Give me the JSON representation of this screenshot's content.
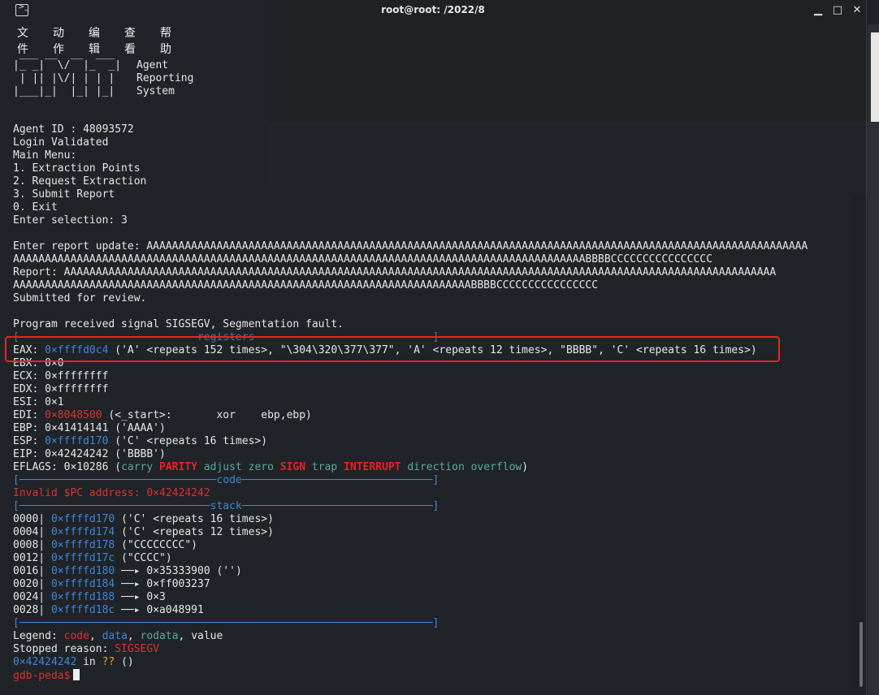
{
  "window": {
    "title": "root@root: /2022/8",
    "min": "▁",
    "max": "□",
    "close": "✕"
  },
  "menu": [
    "文件",
    "动作",
    "编辑",
    "查看",
    "帮助"
  ],
  "banner": {
    "logo_lines": [
      " ___ __  __  ___  ",
      "|_ _|  \\/  |_  _| ",
      " | || |\\/| | | |  ",
      "|___|_|  |_| |_|  "
    ],
    "text": [
      "Agent",
      "Reporting",
      "System"
    ]
  },
  "session": {
    "agent_id": "Agent ID : 48093572",
    "login": "Login Validated",
    "main_menu": "Main Menu:",
    "options": [
      "1. Extraction Points",
      "2. Request Extraction",
      "3. Submit Report",
      "0. Exit"
    ],
    "selection": "Enter selection: 3",
    "update_1": "Enter report update: AAAAAAAAAAAAAAAAAAAAAAAAAAAAAAAAAAAAAAAAAAAAAAAAAAAAAAAAAAAAAAAAAAAAAAAAAAAAAAAAAAAAAAAAAAAAAAAAAAAAAAAA",
    "update_2": "AAAAAAAAAAAAAAAAAAAAAAAAAAAAAAAAAAAAAAAAAAAAAAAAAAAAAAAAAAAAAAAAAAAAAAAAAAAAAAAAAAAAAAAAAABBBBCCCCCCCCCCCCCCCC",
    "report_1": "Report: AAAAAAAAAAAAAAAAAAAAAAAAAAAAAAAAAAAAAAAAAAAAAAAAAAAAAAAAAAAAAAAAAAAAAAAAAAAAAAAAAAAAAAAAAAAAAAAAAAAAAAAAAAAAAAAA",
    "report_2": "AAAAAAAAAAAAAAAAAAAAAAAAAAAAAAAAAAAAAAAAAAAAAAAAAAAAAAAAAAAAAAAAAAAAAAAABBBBCCCCCCCCCCCCCCCC",
    "submitted": "Submitted for review.",
    "signal": "Program received signal SIGSEGV, Segmentation fault."
  },
  "registers": {
    "header": "[────────────────────────────registers────────────────────────────]",
    "eax_name": "EAX:",
    "eax_addr": "0×ffffd0c4",
    "eax_val": "('A' <repeats 152 times>, \"\\304\\320\\377\\377\", 'A' <repeats 12 times>, \"BBBB\", 'C' <repeats 16 times>)",
    "ebx": "EBX: 0×0",
    "ecx": "ECX: 0×ffffffff",
    "edx": "EDX: 0×ffffffff",
    "esi": "ESI: 0×1",
    "edi_name": "EDI:",
    "edi_addr": "0×8048500",
    "edi_val": "(<_start>:       xor    ebp,ebp)",
    "ebp": "EBP: 0×41414141 ('AAAA')",
    "esp_name": "ESP:",
    "esp_addr": "0×ffffd170",
    "esp_val": "('C' <repeats 16 times>)",
    "eip": "EIP: 0×42424242 ('BBBB')",
    "eflags_prefix": "EFLAGS: 0×10286 (",
    "flags": [
      {
        "name": "carry",
        "on": false
      },
      {
        "name": "PARITY",
        "on": true
      },
      {
        "name": "adjust",
        "on": false
      },
      {
        "name": "zero",
        "on": false
      },
      {
        "name": "SIGN",
        "on": true
      },
      {
        "name": "trap",
        "on": false
      },
      {
        "name": "INTERRUPT",
        "on": true
      },
      {
        "name": "direction",
        "on": false
      },
      {
        "name": "overflow",
        "on": false
      }
    ],
    "eflags_suffix": ")"
  },
  "code": {
    "header": "[───────────────────────────────code──────────────────────────────]",
    "invalid": "Invalid $PC address: 0×42424242"
  },
  "stack": {
    "header": "[──────────────────────────────stack──────────────────────────────]",
    "rows": [
      {
        "off": "0000|",
        "addr": "0×ffffd170",
        "val": "('C' <repeats 16 times>)"
      },
      {
        "off": "0004|",
        "addr": "0×ffffd174",
        "val": "('C' <repeats 12 times>)"
      },
      {
        "off": "0008|",
        "addr": "0×ffffd178",
        "val": "(\"CCCCCCCC\")"
      },
      {
        "off": "0012|",
        "addr": "0×ffffd17c",
        "val": "(\"CCCC\")"
      },
      {
        "off": "0016|",
        "addr": "0×ffffd180",
        "val": "──▸ 0×35333900 ('')"
      },
      {
        "off": "0020|",
        "addr": "0×ffffd184",
        "val": "──▸ 0×ff003237"
      },
      {
        "off": "0024|",
        "addr": "0×ffffd188",
        "val": "──▸ 0×3"
      },
      {
        "off": "0028|",
        "addr": "0×ffffd18c",
        "val": "──▸ 0×a048991"
      }
    ],
    "footer": "[─────────────────────────────────────────────────────────────────]"
  },
  "legend": {
    "label": "Legend: ",
    "code": "code",
    "data": "data",
    "rodata": "rodata",
    "value": "value"
  },
  "stopped": {
    "label": "Stopped reason: ",
    "reason": "SIGSEGV"
  },
  "location": {
    "addr": "0×42424242",
    "in": " in ",
    "func": "??",
    "rest": " ()"
  },
  "prompt": "gdb-peda$"
}
